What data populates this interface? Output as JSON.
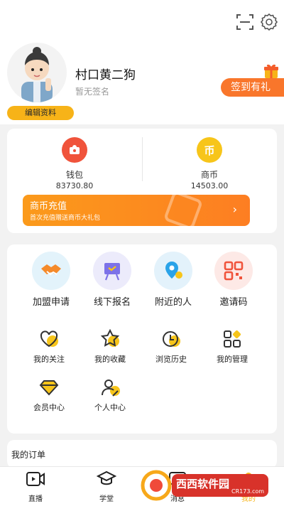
{
  "profile": {
    "name": "村口黄二狗",
    "signature": "暂无签名",
    "edit_label": "编辑资料",
    "checkin_label": "签到有礼"
  },
  "wallet": {
    "label": "钱包",
    "value": "83730.80"
  },
  "coins": {
    "label": "商币",
    "value": "14503.00",
    "symbol": "币"
  },
  "recharge": {
    "title": "商币充值",
    "subtitle": "首次充值赠送商币大礼包"
  },
  "features": [
    {
      "label": "加盟申请",
      "icon": "handshake-icon"
    },
    {
      "label": "线下报名",
      "icon": "easel-icon"
    },
    {
      "label": "附近的人",
      "icon": "location-icon"
    },
    {
      "label": "邀请码",
      "icon": "qrcode-icon"
    }
  ],
  "tools": [
    {
      "label": "我的关注",
      "icon": "heart-icon"
    },
    {
      "label": "我的收藏",
      "icon": "star-icon"
    },
    {
      "label": "浏览历史",
      "icon": "history-icon"
    },
    {
      "label": "我的管理",
      "icon": "grid-icon"
    },
    {
      "label": "会员中心",
      "icon": "diamond-icon"
    },
    {
      "label": "个人中心",
      "icon": "user-edit-icon"
    }
  ],
  "orders": {
    "label": "我的订单"
  },
  "tabs": [
    {
      "label": "直播",
      "icon": "video-icon"
    },
    {
      "label": "学堂",
      "icon": "graduation-cap-icon"
    },
    {
      "label": "消息",
      "icon": "message-icon"
    },
    {
      "label": "我的",
      "icon": "user-icon"
    }
  ],
  "watermark": {
    "brand": "西西软件园",
    "url": "CR173.com"
  },
  "colors": {
    "accent": "#f9762b",
    "yellow": "#f7b318",
    "bg": "#f2f2f2"
  }
}
